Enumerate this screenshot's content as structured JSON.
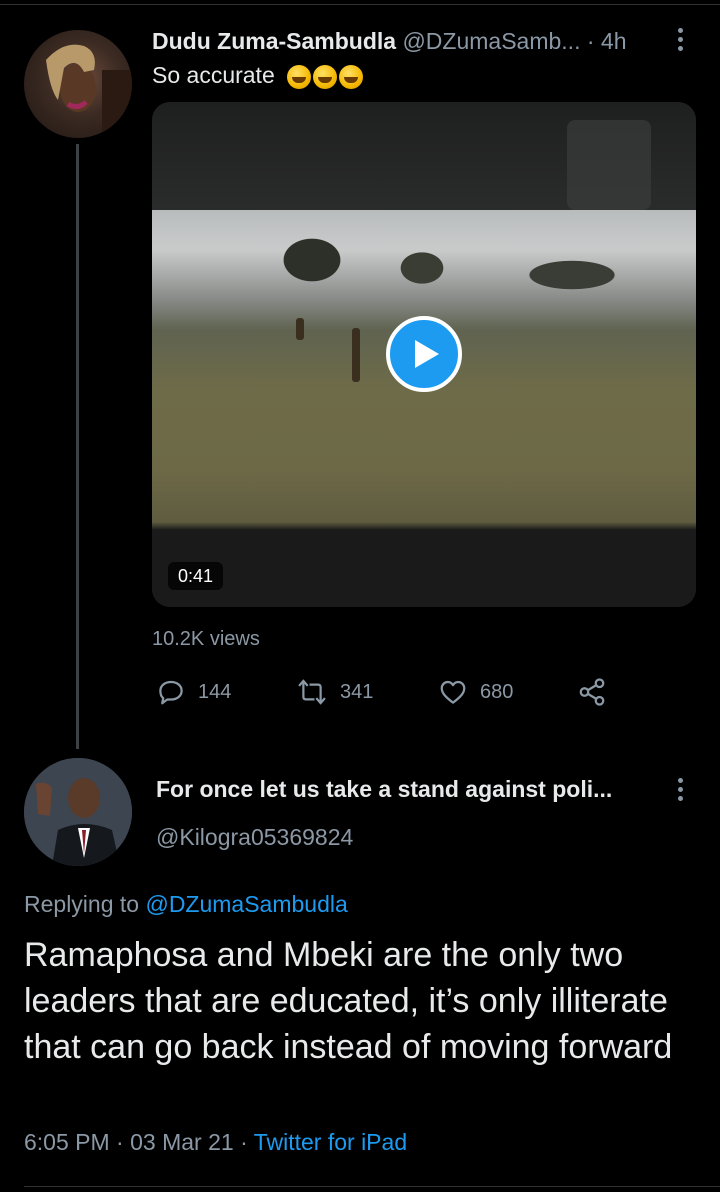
{
  "parent_tweet": {
    "display_name": "Dudu Zuma-Sambudla",
    "handle": "@DZumaSamb...",
    "separator": "·",
    "time": "4h",
    "text": "So accurate",
    "emoji": [
      "rolling-on-floor-laughing",
      "rolling-on-floor-laughing",
      "rolling-on-floor-laughing"
    ],
    "video": {
      "duration": "0:41"
    },
    "views": "10.2K views",
    "actions": {
      "reply_count": "144",
      "retweet_count": "341",
      "like_count": "680"
    }
  },
  "reply_tweet": {
    "display_name": "For once let us take a stand against poli...",
    "handle": "@Kilogra05369824",
    "replying_prefix": "Replying to",
    "replying_to": "@DZumaSambudla",
    "text": "Ramaphosa and Mbeki are the only two leaders that are educated, it’s only illiterate that can go back instead of moving forward",
    "time": "6:05 PM",
    "separator_1": "·",
    "date": "03 Mar 21",
    "separator_2": "·",
    "source": "Twitter for iPad"
  },
  "colors": {
    "background": "#000000",
    "text_primary": "#e7e9ea",
    "text_secondary": "#8b98a5",
    "accent": "#1d9bf0"
  },
  "icons": {
    "more": "more-vertical-icon",
    "reply": "reply-icon",
    "retweet": "retweet-icon",
    "like": "heart-icon",
    "share": "share-icon",
    "play": "play-icon"
  }
}
